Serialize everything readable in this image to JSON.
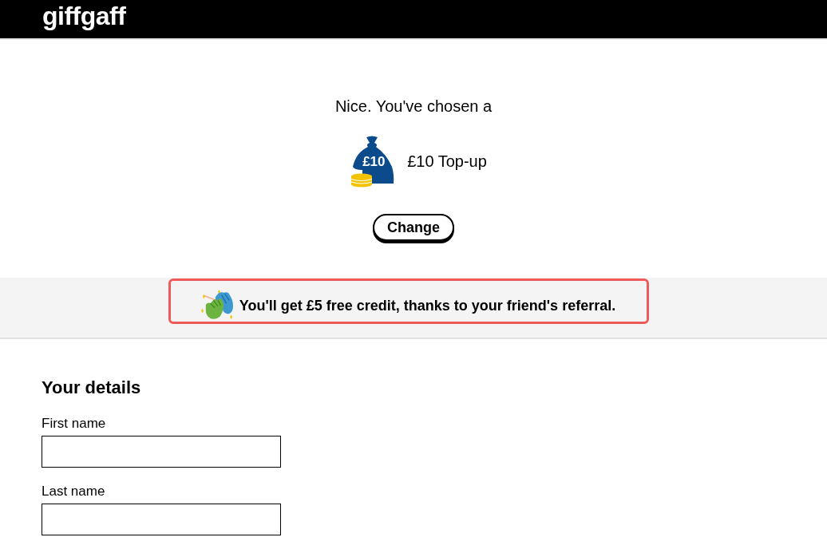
{
  "header": {
    "logo": "giffgaff"
  },
  "selection": {
    "intro": "Nice. You've chosen a",
    "bag_label": "£10",
    "product": "£10 Top-up",
    "change_button": "Change"
  },
  "referral_banner": {
    "message": "You'll get £5 free credit, thanks to your friend's referral."
  },
  "details_form": {
    "heading": "Your details",
    "fields": [
      {
        "label": "First name"
      },
      {
        "label": "Last name"
      }
    ]
  }
}
